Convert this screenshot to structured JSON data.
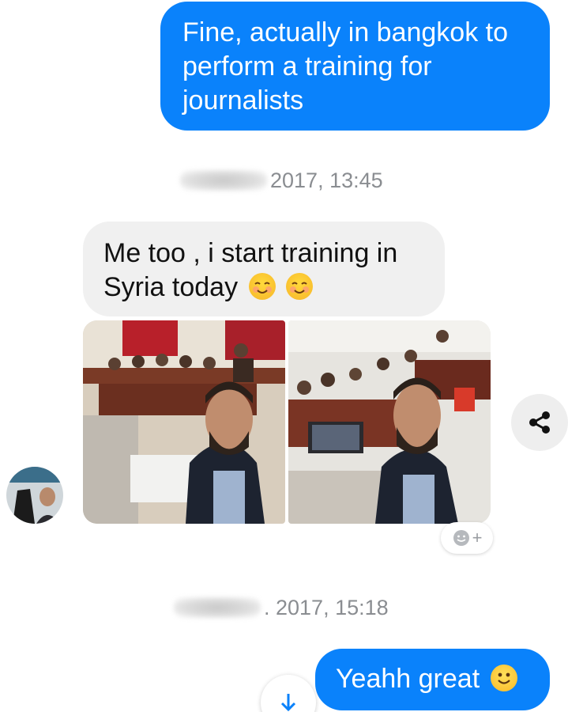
{
  "messages": {
    "outgoing_1": "Fine, actually in bangkok to perform a training for journalists",
    "timestamp_1": "2017, 13:45",
    "incoming_1": "Me too , i start training in Syria today",
    "timestamp_2": ". 2017, 15:18",
    "outgoing_2": "Yeahh great"
  },
  "icons": {
    "share": "share-icon",
    "add_reaction": "add-reaction-icon",
    "scroll_down": "arrow-down-icon",
    "blush_emoji": "smiling-face-with-smiling-eyes",
    "smile_emoji": "slightly-smiling-face"
  },
  "reaction_label": "+",
  "colors": {
    "outgoing_bubble": "#0a82fb",
    "incoming_bubble": "#f0f0f0",
    "timestamp_text": "#8a8d91"
  }
}
